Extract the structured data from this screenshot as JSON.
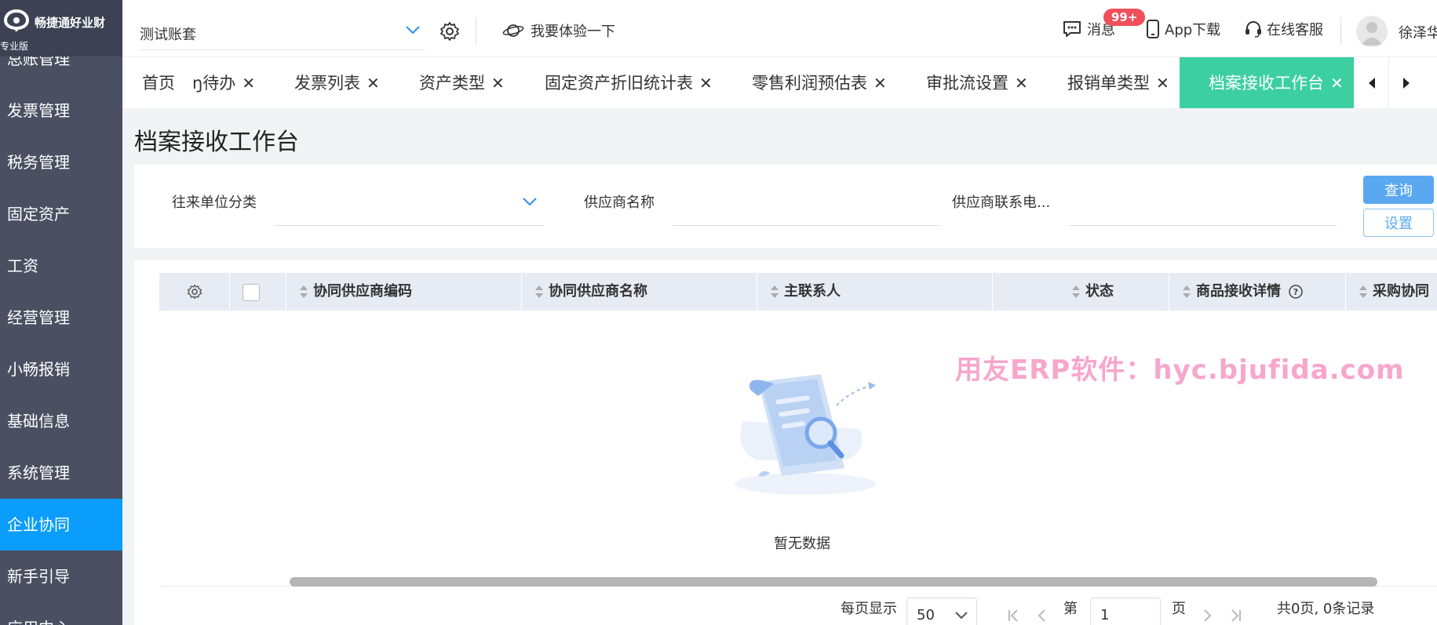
{
  "brand": {
    "name": "畅捷通好业财",
    "edition": "专业版"
  },
  "sidebar": {
    "items": [
      {
        "label": "总账管理"
      },
      {
        "label": "发票管理"
      },
      {
        "label": "税务管理"
      },
      {
        "label": "固定资产"
      },
      {
        "label": "工资"
      },
      {
        "label": "经营管理"
      },
      {
        "label": "小畅报销"
      },
      {
        "label": "基础信息"
      },
      {
        "label": "系统管理"
      },
      {
        "label": "企业协同"
      },
      {
        "label": "新手引导"
      },
      {
        "label": "应用中心"
      }
    ],
    "active_index": 9
  },
  "header": {
    "account": "测试账套",
    "try_label": "我要体验一下",
    "messages_label": "消息",
    "messages_badge": "99+",
    "app_download": "App下载",
    "support": "在线客服",
    "username": "徐泽华"
  },
  "tabs": [
    {
      "label": "首页"
    },
    {
      "label": "ŋ待办"
    },
    {
      "label": "发票列表"
    },
    {
      "label": "资产类型"
    },
    {
      "label": "固定资产折旧统计表"
    },
    {
      "label": "零售利润预估表"
    },
    {
      "label": "审批流设置"
    },
    {
      "label": "报销单类型"
    },
    {
      "label": "档案接收工作台"
    }
  ],
  "page": {
    "title": "档案接收工作台",
    "filters": {
      "partner_category_label": "往来单位分类",
      "supplier_name_label": "供应商名称",
      "supplier_phone_label": "供应商联系电..."
    },
    "query_button": "查询",
    "settings_button": "设置"
  },
  "table": {
    "columns": [
      "协同供应商编码",
      "协同供应商名称",
      "主联系人",
      "状态",
      "商品接收详情",
      "采购协同"
    ],
    "rows": [],
    "empty_text": "暂无数据"
  },
  "watermark": "用友ERP软件：hyc.bjufida.com",
  "pagination": {
    "per_page_label": "每页显示",
    "per_page_value": "50",
    "page_prefix": "第",
    "page_value": "1",
    "page_suffix": "页",
    "summary": "共0页, 0条记录"
  },
  "colors": {
    "sidebar_bg": "#4a5062",
    "sidebar_active": "#0a9dfc",
    "active_tab": "#3ccfa0",
    "primary_button": "#5aa8f0",
    "badge": "#f0505a",
    "watermark": "#f7a6cc"
  }
}
